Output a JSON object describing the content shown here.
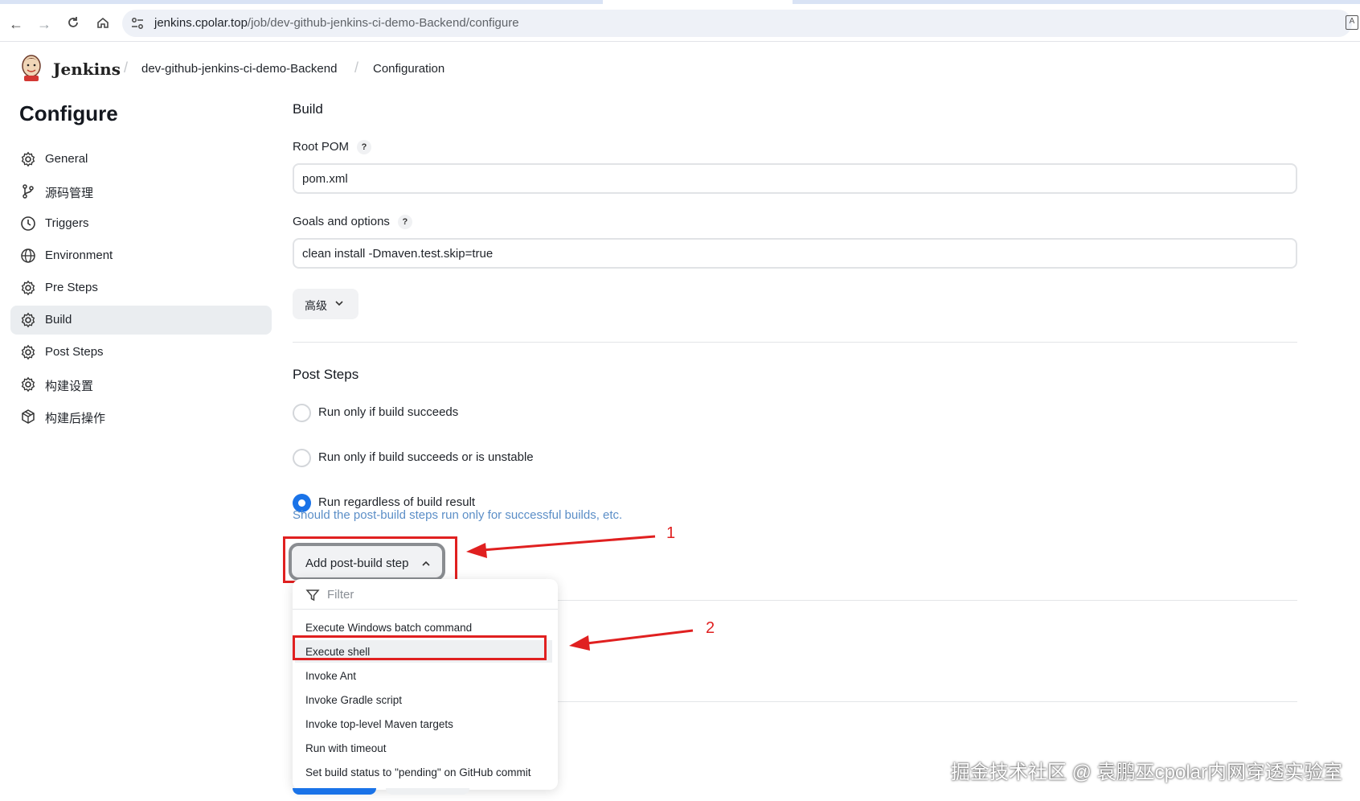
{
  "browser": {
    "url_host": "jenkins.cpolar.top",
    "url_path": "/job/dev-github-jenkins-ci-demo-Backend/configure"
  },
  "header": {
    "brand": "Jenkins",
    "breadcrumbs": [
      "dev-github-jenkins-ci-demo-Backend",
      "Configuration"
    ]
  },
  "sidebar": {
    "title": "Configure",
    "items": [
      {
        "label": "General",
        "icon": "gear-icon"
      },
      {
        "label": "源码管理",
        "icon": "branch-icon"
      },
      {
        "label": "Triggers",
        "icon": "clock-icon"
      },
      {
        "label": "Environment",
        "icon": "globe-icon"
      },
      {
        "label": "Pre Steps",
        "icon": "gear-icon"
      },
      {
        "label": "Build",
        "icon": "gear-icon",
        "active": true
      },
      {
        "label": "Post Steps",
        "icon": "gear-icon"
      },
      {
        "label": "构建设置",
        "icon": "gear-icon"
      },
      {
        "label": "构建后操作",
        "icon": "package-icon"
      }
    ]
  },
  "build": {
    "title": "Build",
    "root_pom_label": "Root POM",
    "root_pom_value": "pom.xml",
    "goals_label": "Goals and options",
    "goals_value": "clean install -Dmaven.test.skip=true",
    "help_mark": "?",
    "advanced_label": "高级"
  },
  "post_steps": {
    "title": "Post Steps",
    "options": [
      {
        "label": "Run only if build succeeds",
        "checked": false
      },
      {
        "label": "Run only if build succeeds or is unstable",
        "checked": false
      },
      {
        "label": "Run regardless of build result",
        "checked": true
      }
    ],
    "hint": "Should the post-build steps run only for successful builds, etc.",
    "add_step_label": "Add post-build step"
  },
  "dropdown": {
    "filter_placeholder": "Filter",
    "items": [
      "Execute Windows batch command",
      "Execute shell",
      "Invoke Ant",
      "Invoke Gradle script",
      "Invoke top-level Maven targets",
      "Run with timeout",
      "Set build status to \"pending\" on GitHub commit"
    ],
    "highlighted_index": 1
  },
  "annotations": {
    "marker_1": "1",
    "marker_2": "2",
    "color": "#e02020"
  },
  "watermark": "掘金技术社区 @ 袁鹏巫cpolar内网穿透实验室",
  "colors": {
    "accent": "#1a73e8",
    "annotation_red": "#e02020",
    "hint_blue": "#5b8ec7"
  }
}
